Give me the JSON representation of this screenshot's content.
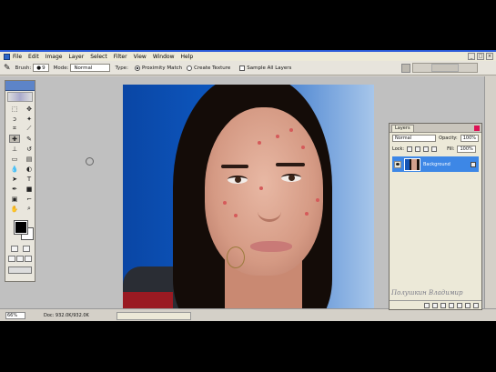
{
  "menubar": {
    "items": [
      "File",
      "Edit",
      "Image",
      "Layer",
      "Select",
      "Filter",
      "View",
      "Window",
      "Help"
    ]
  },
  "options": {
    "brush_label": "Brush:",
    "brush_size": "9",
    "mode_label": "Mode:",
    "mode_value": "Normal",
    "type_label": "Type:",
    "proximity_label": "Proximity Match",
    "create_texture_label": "Create Texture",
    "sample_all_label": "Sample All Layers"
  },
  "status": {
    "zoom": "66%",
    "doc": "Doc: 932.0K/932.0K"
  },
  "layers_panel": {
    "tab": "Layers",
    "blend_mode": "Normal",
    "opacity_label": "Opacity:",
    "opacity": "100%",
    "lock_label": "Lock:",
    "fill_label": "Fill:",
    "fill": "100%",
    "layer_name": "Background"
  },
  "watermark": "Полушкин Владимир",
  "colors": {
    "foreground": "#000000",
    "background": "#ffffff",
    "selection": "#3d87e6"
  }
}
